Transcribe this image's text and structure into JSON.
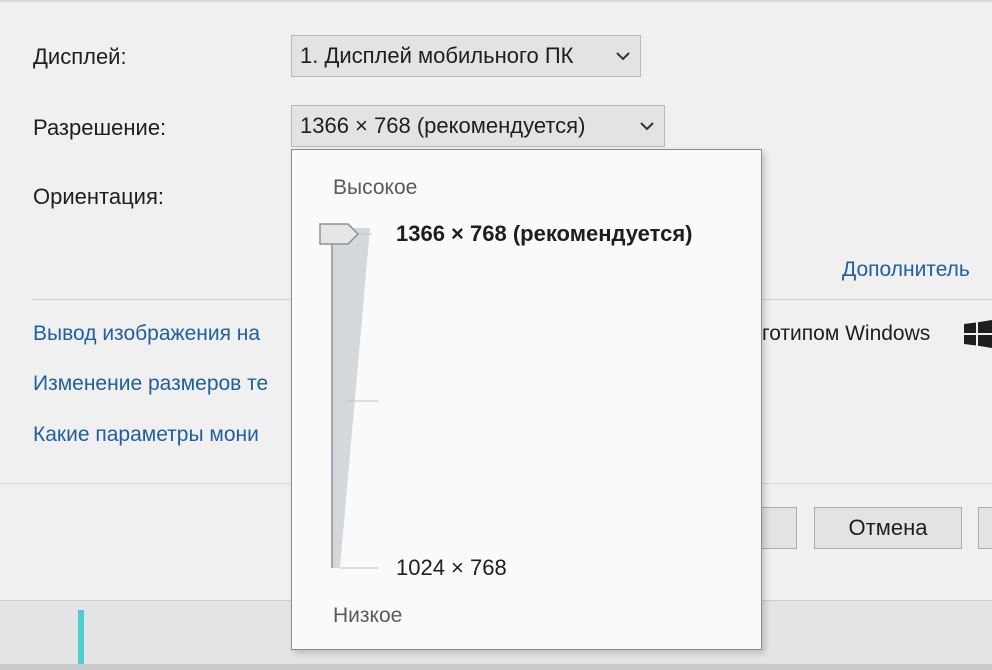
{
  "settings": {
    "display_label": "Дисплей:",
    "display_value": "1. Дисплей мобильного ПК",
    "resolution_label": "Разрешение:",
    "resolution_value": "1366 × 768 (рекомендуется)",
    "orientation_label": "Ориентация:"
  },
  "links": {
    "advanced": "Дополнитель",
    "project": "Вывод изображения на",
    "project_tail": "готипом Windows",
    "resize_text": "Изменение размеров те",
    "monitor_params": "Какие параметры мони"
  },
  "buttons": {
    "cancel": "Отмена"
  },
  "dropdown": {
    "high_label": "Высокое",
    "low_label": "Низкое",
    "selected_option": "1366 × 768 (рекомендуется)",
    "min_option": "1024 × 768",
    "selected_level": 1.0
  },
  "icons": {
    "combo_arrow": "chevron-down-icon",
    "windows_logo": "windows-logo-icon"
  },
  "colors": {
    "link": "#1f5fa0",
    "accent": "#4ccdd0"
  }
}
